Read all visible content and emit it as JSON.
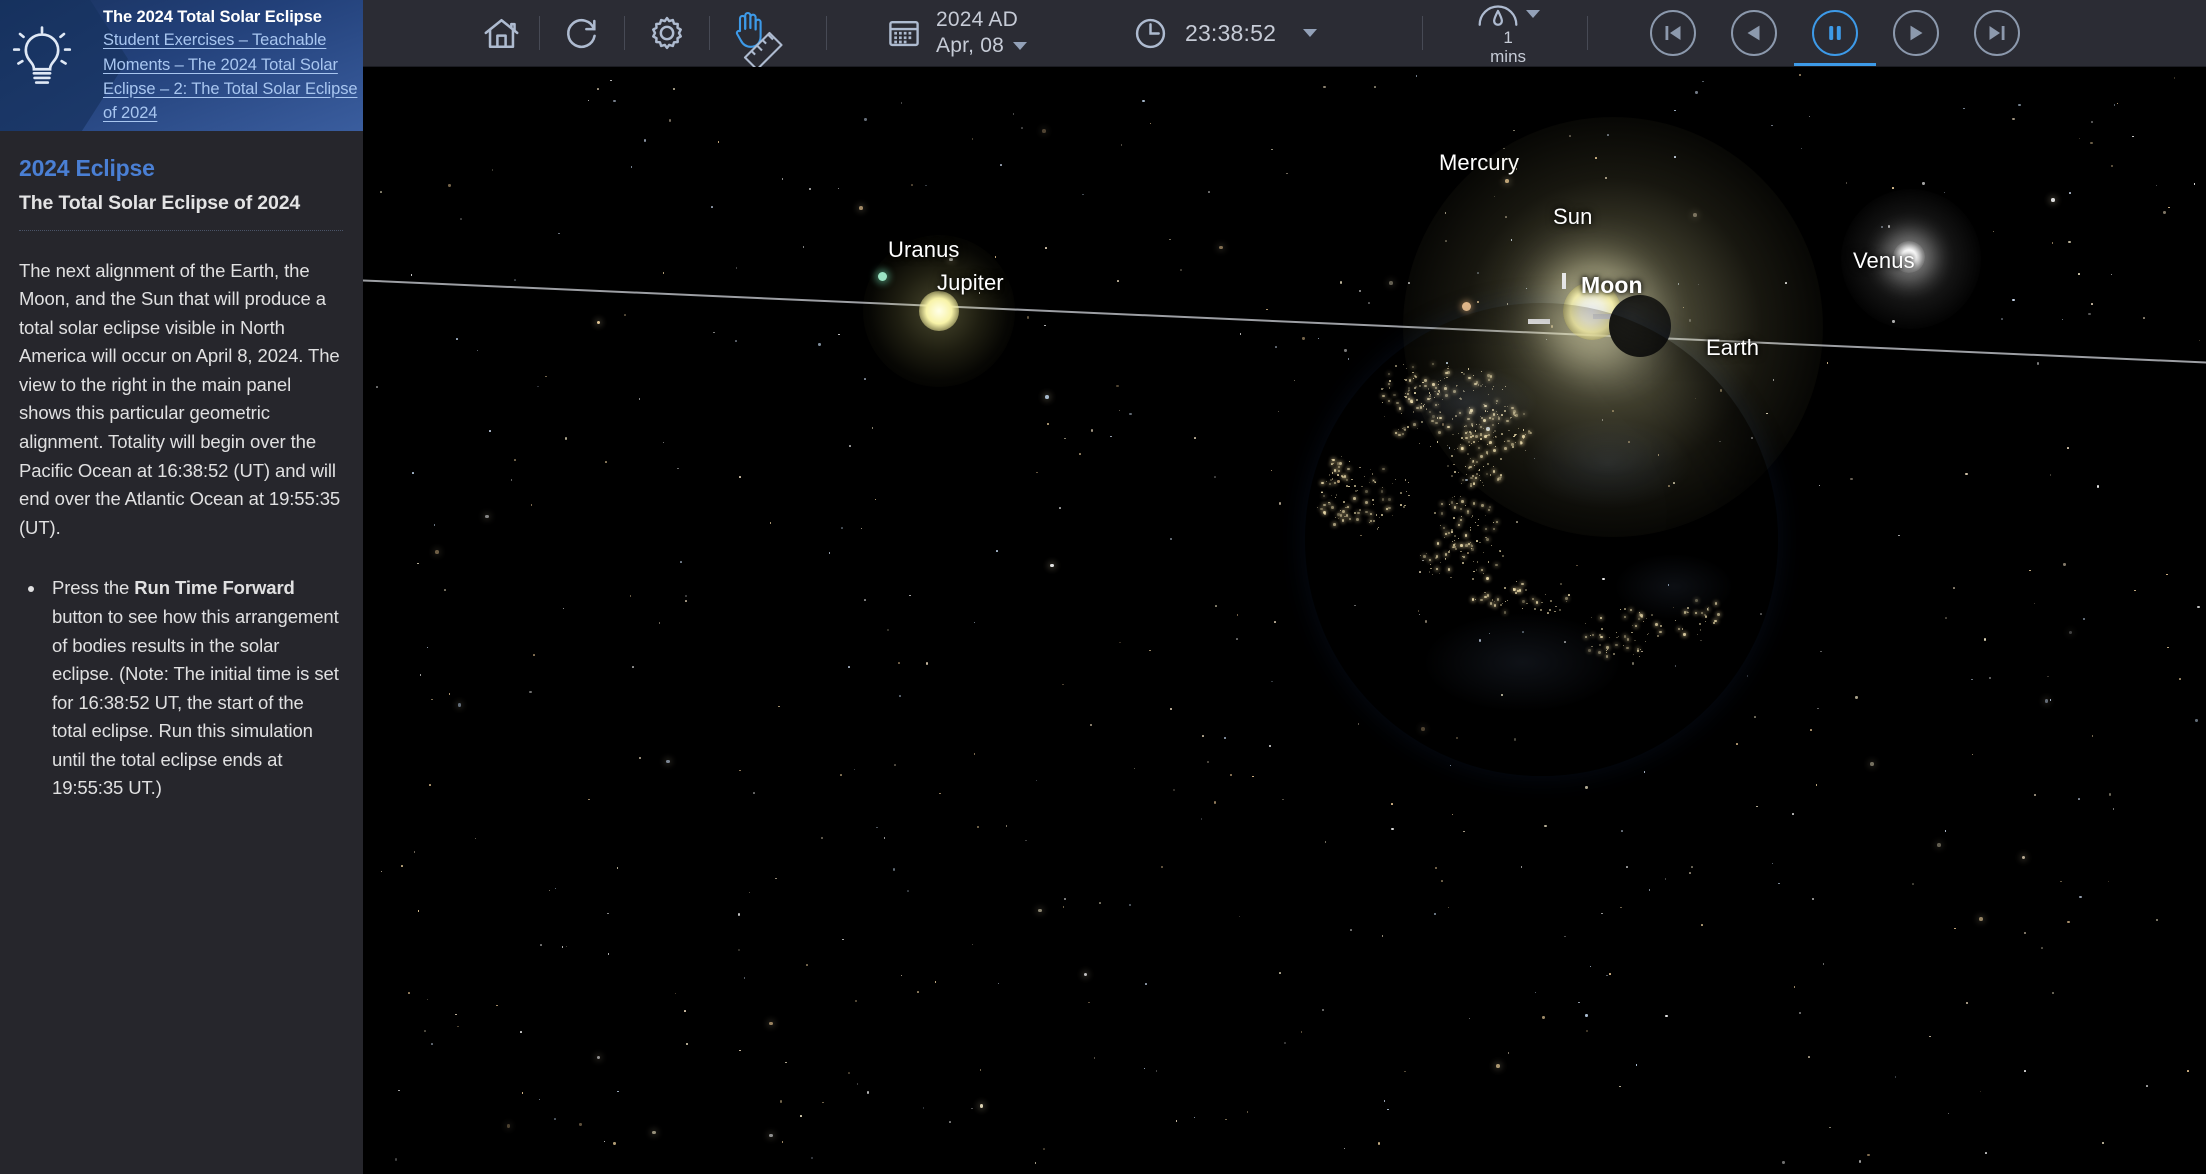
{
  "sidebar": {
    "header": {
      "icon": "lightbulb-icon",
      "title": "The 2024 Total Solar Eclipse",
      "breadcrumb": "Student Exercises – Teachable Moments – The 2024 Total Solar Eclipse – 2: The Total Solar Eclipse of 2024"
    },
    "eyebrow": "2024 Eclipse",
    "heading": "The Total Solar Eclipse of 2024",
    "paragraph": "The next alignment of the Earth, the Moon, and the Sun that will produce a total solar eclipse visible in North America will occur on April 8, 2024. The view to the right in the main panel shows this particular geometric alignment. Totality will begin over the Pacific Ocean at 16:38:52 (UT) and will end over the Atlantic Ocean at 19:55:35 (UT).",
    "bullets": [
      {
        "before": "Press the ",
        "bold": "Run Time Forward",
        "after": " button to see how this arrangement of bodies results in the solar eclipse. (Note: The initial time is set for 16:38:52 UT, the start of the total eclipse. Run this simulation until the total eclipse ends at 19:55:35 UT.)"
      }
    ]
  },
  "toolbar": {
    "home": {
      "icon": "home-icon",
      "label": "Home"
    },
    "reset": {
      "icon": "refresh-icon",
      "label": "Reset"
    },
    "settings": {
      "icon": "gear-icon",
      "label": "Settings"
    },
    "hand_tool": {
      "icon": "hand-icon",
      "label": "Pan",
      "active": true
    },
    "measure_tool": {
      "icon": "ruler-icon",
      "label": "Measure",
      "active": false
    },
    "date": {
      "icon": "calendar-icon",
      "year": "2024 AD",
      "day": "Apr, 08"
    },
    "time": {
      "icon": "clock-icon",
      "value": "23:38:52"
    },
    "speed": {
      "icon": "speed-gauge-icon",
      "value": "1",
      "unit": "mins"
    },
    "playback": [
      {
        "icon": "skip-to-start-icon",
        "label": "Step Back To Start",
        "active": false
      },
      {
        "icon": "reverse-icon",
        "label": "Run Time Backward",
        "active": false
      },
      {
        "icon": "pause-icon",
        "label": "Stop Time",
        "active": true
      },
      {
        "icon": "play-icon",
        "label": "Run Time Forward",
        "active": false
      },
      {
        "icon": "skip-to-end-icon",
        "label": "Step Forward To End",
        "active": false
      }
    ],
    "accent_color": "#3d9ae8",
    "background_color": "#2b2c34"
  },
  "sky": {
    "labels": {
      "mercury": "Mercury",
      "uranus": "Uranus",
      "jupiter": "Jupiter",
      "sun": "Sun",
      "moon": "Moon",
      "venus": "Venus",
      "earth": "Earth"
    },
    "background_color": "#000000",
    "ecliptic_line_color": "#c9ccd2"
  }
}
